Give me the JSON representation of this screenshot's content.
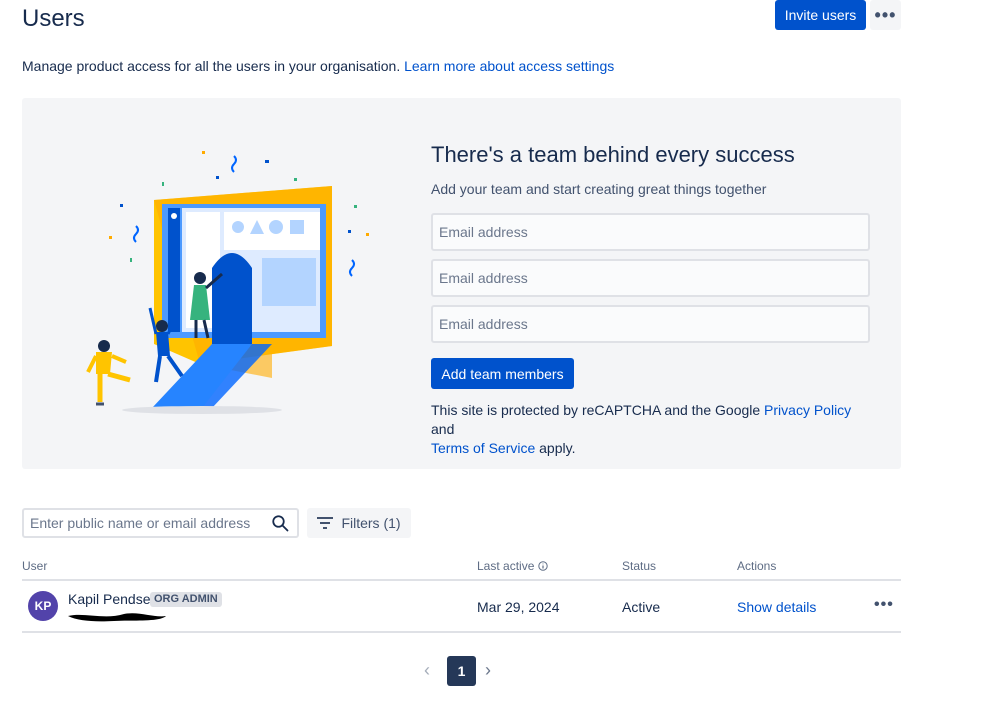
{
  "header": {
    "title": "Users",
    "invite_label": "Invite users"
  },
  "intro": {
    "text": "Manage product access for all the users in your organisation. ",
    "link": "Learn more about access settings"
  },
  "invite_panel": {
    "heading": "There's a team behind every success",
    "description": "Add your team and start creating great things together",
    "email_placeholder": "Email address",
    "add_button": "Add team members",
    "captcha_prefix": "This site is protected by reCAPTCHA and the Google ",
    "privacy_link": "Privacy Policy",
    "captcha_and": " and",
    "terms_link": "Terms of Service",
    "captcha_suffix": " apply."
  },
  "toolbar": {
    "search_placeholder": "Enter public name or email address",
    "filters_label": "Filters (1)"
  },
  "table": {
    "columns": [
      "User",
      "Last active",
      "Status",
      "Actions"
    ],
    "rows": [
      {
        "initials": "KP",
        "name": "Kapil Pendse",
        "badge": "ORG ADMIN",
        "last_active": "Mar 29, 2024",
        "status": "Active",
        "action": "Show details"
      }
    ]
  },
  "pagination": {
    "current_page": "1"
  },
  "colors": {
    "primary": "#0052cc",
    "avatar": "#5243aa",
    "panel": "#f4f5f7"
  }
}
